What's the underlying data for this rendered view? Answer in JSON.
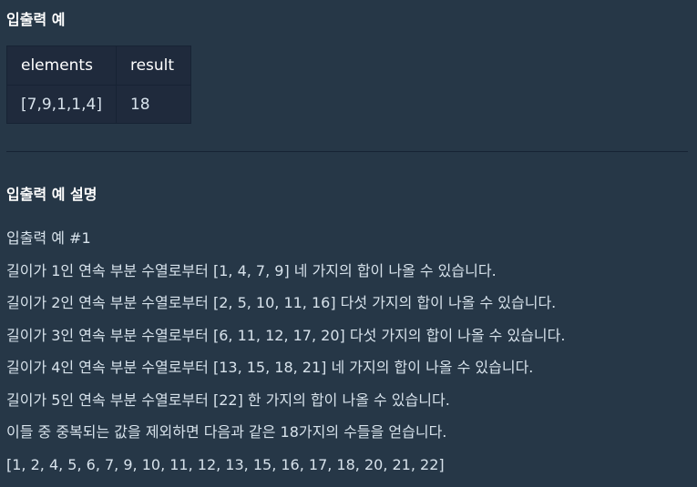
{
  "examples": {
    "title": "입출력 예",
    "headers": [
      "elements",
      "result"
    ],
    "rows": [
      [
        "[7,9,1,1,4]",
        "18"
      ]
    ]
  },
  "explanation": {
    "title": "입출력 예 설명",
    "lines": [
      "입출력 예 #1",
      "길이가 1인 연속 부분 수열로부터 [1, 4, 7, 9] 네 가지의 합이 나올 수 있습니다.",
      "길이가 2인 연속 부분 수열로부터 [2, 5, 10, 11, 16] 다섯 가지의 합이 나올 수 있습니다.",
      "길이가 3인 연속 부분 수열로부터 [6, 11, 12, 17, 20] 다섯 가지의 합이 나올 수 있습니다.",
      "길이가 4인 연속 부분 수열로부터 [13, 15, 18, 21] 네 가지의 합이 나올 수 있습니다.",
      "길이가 5인 연속 부분 수열로부터 [22] 한 가지의 합이 나올 수 있습니다.",
      "이들 중 중복되는 값을 제외하면 다음과 같은 18가지의 수들을 얻습니다.",
      "[1, 2, 4, 5, 6, 7, 9, 10, 11, 12, 13, 15, 16, 17, 18, 20, 21, 22]"
    ]
  }
}
